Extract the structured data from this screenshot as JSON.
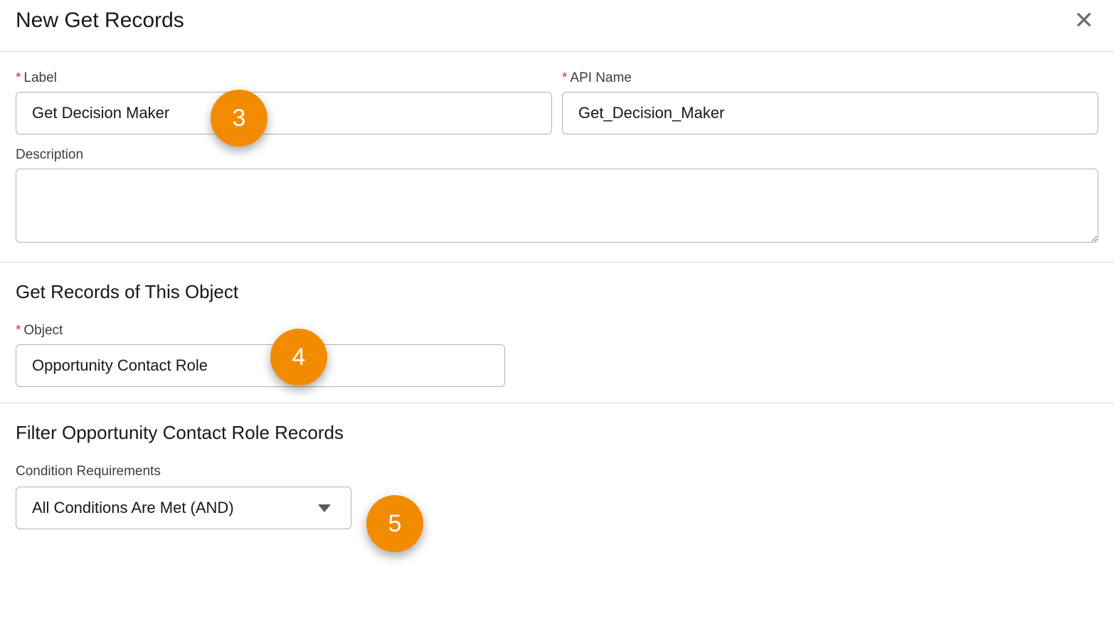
{
  "header": {
    "title": "New Get Records"
  },
  "fields": {
    "label_label": "Label",
    "label_value": "Get Decision Maker",
    "apiname_label": "API Name",
    "apiname_value": "Get_Decision_Maker",
    "description_label": "Description",
    "description_value": ""
  },
  "object_section": {
    "heading": "Get Records of This Object",
    "object_label": "Object",
    "object_value": "Opportunity Contact Role"
  },
  "filter_section": {
    "heading": "Filter Opportunity Contact Role Records",
    "condition_label": "Condition Requirements",
    "condition_value": "All Conditions Are Met (AND)"
  },
  "callouts": {
    "c3": "3",
    "c4": "4",
    "c5": "5"
  }
}
